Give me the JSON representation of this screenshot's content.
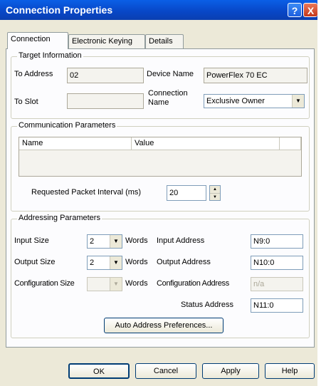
{
  "window": {
    "title": "Connection Properties",
    "help_glyph": "?",
    "close_glyph": "X"
  },
  "tabs": [
    {
      "label": "Connection"
    },
    {
      "label": "Electronic Keying"
    },
    {
      "label": "Details"
    }
  ],
  "target_information": {
    "title": "Target Information",
    "to_address_label": "To Address",
    "to_address_value": "02",
    "to_slot_label": "To Slot",
    "to_slot_value": "",
    "device_name_label": "Device Name",
    "device_name_value": "PowerFlex 70 EC",
    "connection_name_label_1": "Connection",
    "connection_name_label_2": "Name",
    "connection_name_value": "Exclusive Owner"
  },
  "communication_parameters": {
    "title": "Communication Parameters",
    "columns": [
      "Name",
      "Value"
    ],
    "rpi_label": "Requested Packet Interval (ms)",
    "rpi_value": "20"
  },
  "addressing_parameters": {
    "title": "Addressing Parameters",
    "input_size_label": "Input Size",
    "input_size_value": "2",
    "output_size_label": "Output Size",
    "output_size_value": "2",
    "config_size_label": "Configuration Size",
    "config_size_value": "",
    "words_label": "Words",
    "input_address_label": "Input Address",
    "input_address_value": "N9:0",
    "output_address_label": "Output Address",
    "output_address_value": "N10:0",
    "config_address_label": "Configuration Address",
    "config_address_value": "n/a",
    "status_address_label": "Status Address",
    "status_address_value": "N11:0",
    "auto_address_button": "Auto Address Preferences..."
  },
  "buttons": {
    "ok": "OK",
    "cancel": "Cancel",
    "apply": "Apply",
    "help": "Help"
  },
  "glyphs": {
    "dropdown": "▼",
    "spin_up": "▲",
    "spin_down": "▼"
  },
  "colors": {
    "titlebar": "#0846c6",
    "dialog_bg": "#ece9d8",
    "panel_bg": "#fcfcfe"
  }
}
